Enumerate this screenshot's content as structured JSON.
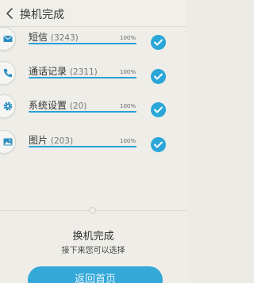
{
  "header": {
    "title": "换机完成"
  },
  "items": [
    {
      "name": "短信",
      "count": "(3243)",
      "percent": "100%",
      "progress": 1.0,
      "icon": "message-icon",
      "checked": true
    },
    {
      "name": "通话记录",
      "count": "(2311)",
      "percent": "100%",
      "progress": 1.0,
      "icon": "phone-icon",
      "checked": true
    },
    {
      "name": "系统设置",
      "count": "(20)",
      "percent": "100%",
      "progress": 1.0,
      "icon": "settings-icon",
      "checked": true
    },
    {
      "name": "图片",
      "count": "(203)",
      "percent": "100%",
      "progress": 1.0,
      "icon": "image-icon",
      "checked": true
    }
  ],
  "done": {
    "title": "换机完成",
    "subtitle": "接下来您可以选择"
  },
  "home_button": {
    "label": "返回首页"
  },
  "colors": {
    "accent": "#2aa6d8",
    "background": "#eeede8"
  }
}
